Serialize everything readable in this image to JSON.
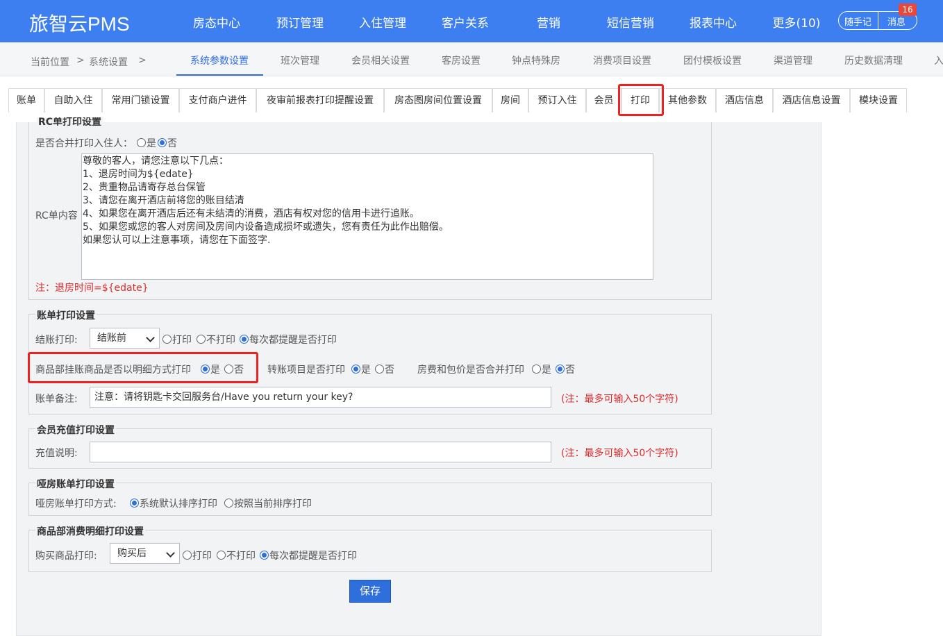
{
  "app": {
    "logo": "旅智云PMS",
    "nav": [
      "房态中心",
      "预订管理",
      "入住管理",
      "客户关系",
      "营销",
      "短信营销",
      "报表中心",
      "更多(10)"
    ],
    "notes_label": "随手记",
    "messages_label": "消息",
    "messages_count": "16"
  },
  "breadcrumb": {
    "current": "当前位置",
    "sep1": ">",
    "section": "系统设置",
    "sep2": ">"
  },
  "subtabs": [
    "系统参数设置",
    "班次管理",
    "会员相关设置",
    "客房设置",
    "钟点特殊房",
    "消费项目设置",
    "团付模板设置",
    "渠道管理",
    "历史数据清理",
    "入"
  ],
  "tabs": [
    "账单",
    "自助入住",
    "常用门锁设置",
    "支付商户进件",
    "夜审前报表打印提醒设置",
    "房态图房间位置设置",
    "房间",
    "预订入住",
    "会员",
    "打印",
    "其他参数",
    "酒店信息",
    "酒店信息设置",
    "模块设置"
  ],
  "active_tab": "打印",
  "rc": {
    "legend": "RC单打印设置",
    "merge_label": "是否合并打印入住人：",
    "yes": "是",
    "no": "否",
    "content_label": "RC单内容",
    "content_lines": [
      "尊敬的客人，请您注意以下几点：",
      "1、退房时间为${edate}",
      "2、贵重物品请寄存总台保管",
      "3、请您在离开酒店前将您的账目结清",
      "4、如果您在离开酒店后还有未结清的消费，酒店有权对您的信用卡进行追账。",
      "5、如果您或您的客人对房间及房间内设备造成损坏或遗失，您有责任为此作出赔偿。",
      "如果您认可以上注意事项，请您在下面签字."
    ],
    "note": "注：退房时间=${edate}"
  },
  "bill": {
    "legend": "账单打印设置",
    "checkout_label": "结账打印:",
    "checkout_select": "结账前",
    "opt_print": "打印",
    "opt_noprint": "不打印",
    "opt_ask": "每次都提醒是否打印",
    "goods_detail_label": "商品部挂账商品是否以明细方式打印",
    "transfer_label": "转账项目是否打印",
    "room_pkg_label": "房费和包价是否合并打印",
    "yes": "是",
    "no": "否",
    "remark_label": "账单备注:",
    "remark_value": "注意：请将钥匙卡交回服务台/Have you return your key?",
    "remark_hint": "(注：最多可输入50个字符)"
  },
  "member": {
    "legend": "会员充值打印设置",
    "desc_label": "充值说明:",
    "desc_value": "",
    "hint": "(注：最多可输入50个字符)"
  },
  "dummy": {
    "legend": "哑房账单打印设置",
    "mode_label": "哑房账单打印方式:",
    "opt_default": "系统默认排序打印",
    "opt_current": "按照当前排序打印"
  },
  "goods": {
    "legend": "商品部消费明细打印设置",
    "buy_label": "购买商品打印:",
    "buy_select": "购买后",
    "opt_print": "打印",
    "opt_noprint": "不打印",
    "opt_ask": "每次都提醒是否打印"
  },
  "save_label": "保存",
  "colors": {
    "topbar": "#3d7ef0",
    "accent": "#2f6fdc",
    "highlight": "#ee2020"
  }
}
